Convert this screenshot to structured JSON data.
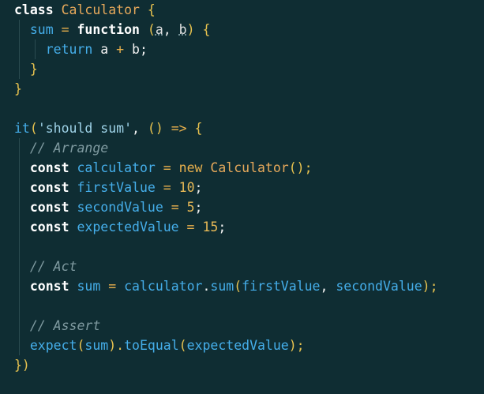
{
  "editor": {
    "lines": [
      [
        {
          "t": "class ",
          "c": "kw"
        },
        {
          "t": "Calculator",
          "c": "cls"
        },
        {
          "t": " {",
          "c": "punc"
        }
      ],
      [
        {
          "t": "  ",
          "c": "plain"
        },
        {
          "t": "sum",
          "c": "var"
        },
        {
          "t": " = ",
          "c": "op"
        },
        {
          "t": "function",
          "c": "kw"
        },
        {
          "t": " (",
          "c": "punc"
        },
        {
          "t": "a",
          "c": "param"
        },
        {
          "t": ", ",
          "c": "plain"
        },
        {
          "t": "b",
          "c": "param"
        },
        {
          "t": ") {",
          "c": "punc"
        }
      ],
      [
        {
          "t": "    ",
          "c": "plain"
        },
        {
          "t": "return",
          "c": "kw-soft"
        },
        {
          "t": " a ",
          "c": "plain"
        },
        {
          "t": "+",
          "c": "op"
        },
        {
          "t": " b;",
          "c": "plain"
        }
      ],
      [
        {
          "t": "  ",
          "c": "plain"
        },
        {
          "t": "}",
          "c": "punc"
        }
      ],
      [
        {
          "t": "}",
          "c": "punc"
        }
      ],
      [],
      [
        {
          "t": "it",
          "c": "fn"
        },
        {
          "t": "(",
          "c": "punc"
        },
        {
          "t": "'should sum'",
          "c": "str"
        },
        {
          "t": ", ",
          "c": "plain"
        },
        {
          "t": "()",
          "c": "punc"
        },
        {
          "t": " => ",
          "c": "op"
        },
        {
          "t": "{",
          "c": "punc"
        }
      ],
      [
        {
          "t": "  ",
          "c": "plain"
        },
        {
          "t": "// Arrange",
          "c": "cmt"
        }
      ],
      [
        {
          "t": "  ",
          "c": "plain"
        },
        {
          "t": "const",
          "c": "kw"
        },
        {
          "t": " calculator",
          "c": "var"
        },
        {
          "t": " = ",
          "c": "op"
        },
        {
          "t": "new",
          "c": "op"
        },
        {
          "t": " Calculator",
          "c": "cls"
        },
        {
          "t": "();",
          "c": "punc"
        }
      ],
      [
        {
          "t": "  ",
          "c": "plain"
        },
        {
          "t": "const",
          "c": "kw"
        },
        {
          "t": " firstValue",
          "c": "var"
        },
        {
          "t": " = ",
          "c": "op"
        },
        {
          "t": "10",
          "c": "num"
        },
        {
          "t": ";",
          "c": "plain"
        }
      ],
      [
        {
          "t": "  ",
          "c": "plain"
        },
        {
          "t": "const",
          "c": "kw"
        },
        {
          "t": " secondValue",
          "c": "var"
        },
        {
          "t": " = ",
          "c": "op"
        },
        {
          "t": "5",
          "c": "num"
        },
        {
          "t": ";",
          "c": "plain"
        }
      ],
      [
        {
          "t": "  ",
          "c": "plain"
        },
        {
          "t": "const",
          "c": "kw"
        },
        {
          "t": " expectedValue",
          "c": "var"
        },
        {
          "t": " = ",
          "c": "op"
        },
        {
          "t": "15",
          "c": "num"
        },
        {
          "t": ";",
          "c": "plain"
        }
      ],
      [],
      [
        {
          "t": "  ",
          "c": "plain"
        },
        {
          "t": "// Act",
          "c": "cmt"
        }
      ],
      [
        {
          "t": "  ",
          "c": "plain"
        },
        {
          "t": "const",
          "c": "kw"
        },
        {
          "t": " sum",
          "c": "var"
        },
        {
          "t": " = ",
          "c": "op"
        },
        {
          "t": "calculator",
          "c": "var"
        },
        {
          "t": ".",
          "c": "plain"
        },
        {
          "t": "sum",
          "c": "fn"
        },
        {
          "t": "(",
          "c": "punc"
        },
        {
          "t": "firstValue",
          "c": "var"
        },
        {
          "t": ", ",
          "c": "plain"
        },
        {
          "t": "secondValue",
          "c": "var"
        },
        {
          "t": ");",
          "c": "punc"
        }
      ],
      [],
      [
        {
          "t": "  ",
          "c": "plain"
        },
        {
          "t": "// Assert",
          "c": "cmt"
        }
      ],
      [
        {
          "t": "  ",
          "c": "plain"
        },
        {
          "t": "expect",
          "c": "fn"
        },
        {
          "t": "(",
          "c": "punc"
        },
        {
          "t": "sum",
          "c": "var"
        },
        {
          "t": ").",
          "c": "punc"
        },
        {
          "t": "toEqual",
          "c": "fn"
        },
        {
          "t": "(",
          "c": "punc"
        },
        {
          "t": "expectedValue",
          "c": "var"
        },
        {
          "t": ");",
          "c": "punc"
        }
      ],
      [
        {
          "t": "})",
          "c": "punc"
        }
      ]
    ]
  }
}
